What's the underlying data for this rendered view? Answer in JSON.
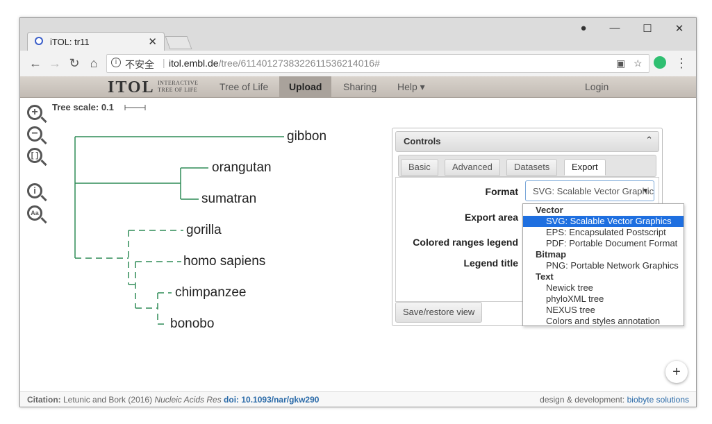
{
  "browser": {
    "tab_title": "iTOL: tr11",
    "tab_close": "✕",
    "security_label": "不安全",
    "url_host": "itol.embl.de",
    "url_path": "/tree/61140127383226115362140​16#"
  },
  "itol_nav": {
    "logo": "ITOL",
    "logo_sub_1": "INTERACTIVE",
    "logo_sub_2": "TREE OF LIFE",
    "items": [
      "Tree of Life",
      "Upload",
      "Sharing",
      "Help ▾",
      "Login"
    ],
    "active": "Upload"
  },
  "tree": {
    "scale_label": "Tree scale: 0.1",
    "leaves": [
      "gibbon",
      "orangutan",
      "sumatran",
      "gorilla",
      "homo sapiens",
      "chimpanzee",
      "bonobo"
    ],
    "solid_color": "#2e8b57",
    "dashed_color": "#2e8b57"
  },
  "controls": {
    "title": "Controls",
    "tabs": [
      "Basic",
      "Advanced",
      "Datasets",
      "Export"
    ],
    "active_tab": "Export",
    "labels": {
      "format": "Format",
      "export_area": "Export area",
      "colored_ranges": "Colored ranges legend",
      "legend_title": "Legend title"
    },
    "format_value": "SVG: Scalable Vector Graphics",
    "save_button": "Save/restore view"
  },
  "dropdown": {
    "groups": [
      {
        "label": "Vector",
        "options": [
          "SVG: Scalable Vector Graphics",
          "EPS: Encapsulated Postscript",
          "PDF: Portable Document Format"
        ]
      },
      {
        "label": "Bitmap",
        "options": [
          "PNG: Portable Network Graphics"
        ]
      },
      {
        "label": "Text",
        "options": [
          "Newick tree",
          "phyloXML tree",
          "NEXUS tree",
          "Colors and styles annotation"
        ]
      }
    ],
    "selected": "SVG: Scalable Vector Graphics"
  },
  "footer": {
    "citation_label": "Citation:",
    "citation_text": "Letunic and Bork (2016)",
    "journal": "Nucleic Acids Res",
    "doi": "doi: 10.1093/nar/gkw290",
    "credit_text": "design & development:",
    "credit_link": "biobyte solutions"
  },
  "fab_label": "+"
}
